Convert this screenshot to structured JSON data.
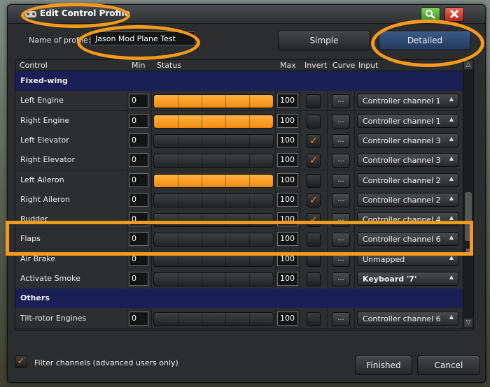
{
  "window": {
    "title": "Edit Control Profile"
  },
  "profile": {
    "name_label": "Name of profile:",
    "name_value": "Jason Mod Plane Test"
  },
  "mode_buttons": {
    "simple": "Simple",
    "detailed": "Detailed"
  },
  "columns": [
    "Control",
    "Min",
    "Status",
    "Max",
    "Invert",
    "Curve",
    "Input"
  ],
  "rows": [
    {
      "type": "section",
      "label": "Fixed-wing"
    },
    {
      "type": "item",
      "label": "Left Engine",
      "min": "0",
      "status": 1.0,
      "max": "100",
      "invert": false,
      "curve": "...",
      "input": "Controller channel 1",
      "bold": false
    },
    {
      "type": "item",
      "label": "Right Engine",
      "min": "0",
      "status": 1.0,
      "max": "100",
      "invert": false,
      "curve": "...",
      "input": "Controller channel 1",
      "bold": false
    },
    {
      "type": "item",
      "label": "Left Elevator",
      "min": "0",
      "status": 0.0,
      "max": "100",
      "invert": true,
      "curve": "...",
      "input": "Controller channel 3",
      "bold": false
    },
    {
      "type": "item",
      "label": "Right Elevator",
      "min": "0",
      "status": 0.0,
      "max": "100",
      "invert": true,
      "curve": "...",
      "input": "Controller channel 3",
      "bold": false
    },
    {
      "type": "item",
      "label": "Left Aileron",
      "min": "0",
      "status": 1.0,
      "max": "100",
      "invert": false,
      "curve": "...",
      "input": "Controller channel 2",
      "bold": false
    },
    {
      "type": "item",
      "label": "Right Aileron",
      "min": "0",
      "status": 0.0,
      "max": "100",
      "invert": true,
      "curve": "...",
      "input": "Controller channel 2",
      "bold": false
    },
    {
      "type": "item",
      "label": "Rudder",
      "min": "0",
      "status": 0.0,
      "max": "100",
      "invert": true,
      "curve": "...",
      "input": "Controller channel 4",
      "bold": false
    },
    {
      "type": "item",
      "label": "Flaps",
      "min": "0",
      "status": 0.0,
      "max": "100",
      "invert": false,
      "curve": "...",
      "input": "Controller channel 6",
      "bold": false
    },
    {
      "type": "item",
      "label": "Air Brake",
      "min": "0",
      "status": 0.0,
      "max": "100",
      "invert": false,
      "curve": "...",
      "input": "Unmapped",
      "bold": false
    },
    {
      "type": "item",
      "label": "Activate Smoke",
      "min": "0",
      "status": 0.0,
      "max": "100",
      "invert": false,
      "curve": "...",
      "input": "Keyboard '7'",
      "bold": true
    },
    {
      "type": "section",
      "label": "Others"
    },
    {
      "type": "item",
      "label": "Tilt-rotor Engines",
      "min": "0",
      "status": 0.0,
      "max": "100",
      "invert": false,
      "curve": "...",
      "input": "Controller channel 6",
      "bold": false
    }
  ],
  "footer": {
    "filter_label": "Filter channels (advanced users only)",
    "filter_checked": true,
    "finished": "Finished",
    "cancel": "Cancel"
  },
  "icons": {
    "check": "✓",
    "dropdown_arrow": "▲",
    "scroll_up": "△",
    "scroll_down": "▽",
    "scroll_grip": "≡"
  },
  "colors": {
    "accent_orange": "#f59a1b",
    "section_bg": "#1a1f55",
    "bar_fill": "#f18a10",
    "close_red": "#c43526",
    "search_green": "#4ba832"
  }
}
